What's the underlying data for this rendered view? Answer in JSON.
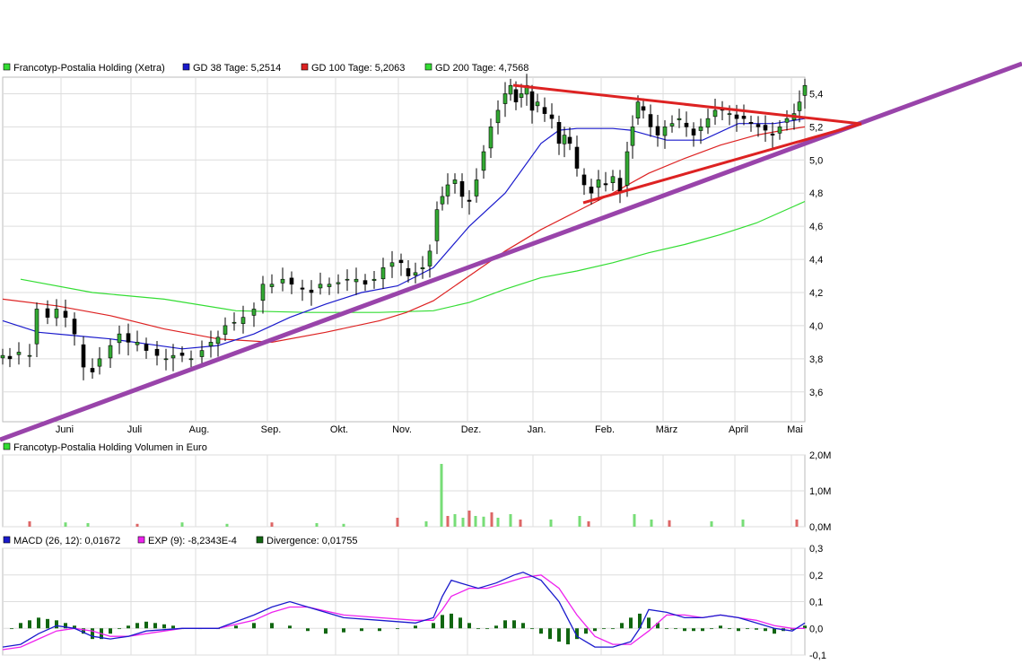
{
  "colors": {
    "price_up": "#33aa33",
    "price_down": "#000000",
    "gd38": "#1a1acc",
    "gd100": "#dd2222",
    "gd200": "#33dd33",
    "trend_red": "#dd2222",
    "trend_purple": "#9944aa",
    "vol_up": "#77dd77",
    "vol_down": "#dd6666",
    "macd": "#1a1acc",
    "exp": "#ee22ee",
    "divergence": "#116611",
    "grid": "#dddddd"
  },
  "panels": {
    "price": {
      "legend": [
        {
          "label": "Francotyp-Postalia Holding (Xetra)",
          "color": "#33dd33",
          "icon": "green-square-icon"
        },
        {
          "label": "GD 38 Tage: 5,2514",
          "color": "#1a1acc",
          "icon": "blue-square-icon"
        },
        {
          "label": "GD 100 Tage: 5,2063",
          "color": "#dd2222",
          "icon": "red-square-icon"
        },
        {
          "label": "GD 200 Tage: 4,7568",
          "color": "#33dd33",
          "icon": "green-square-icon"
        }
      ]
    },
    "volume": {
      "legend": [
        {
          "label": "Francotyp-Postalia Holding Volumen in Euro",
          "color": "#33dd33",
          "icon": "green-square-icon"
        }
      ]
    },
    "macd": {
      "legend": [
        {
          "label": "MACD (26, 12): 0,01672",
          "color": "#1a1acc",
          "icon": "blue-square-icon"
        },
        {
          "label": "EXP (9): -8,2343E-4",
          "color": "#ee22ee",
          "icon": "magenta-square-icon"
        },
        {
          "label": "Divergence: 0,01755",
          "color": "#116611",
          "icon": "darkgreen-square-icon"
        }
      ]
    }
  },
  "chart_data": [
    {
      "type": "line",
      "title": "",
      "x_axis": "time",
      "months": [
        "Juni",
        "Juli",
        "Aug.",
        "Sep.",
        "Okt.",
        "Nov.",
        "Dez.",
        "Jan.",
        "Feb.",
        "März",
        "April",
        "Mai"
      ],
      "yticks": [
        "3,6",
        "3,8",
        "4,0",
        "4,2",
        "4,4",
        "4,6",
        "4,8",
        "5,0",
        "5,2",
        "5,4"
      ],
      "ylim": [
        3.42,
        5.5
      ],
      "grid": true,
      "legend_position": "top-left",
      "series": [
        {
          "name": "Francotyp-Postalia Holding (Xetra)",
          "style": "candlestick",
          "x": [
            0,
            8,
            18,
            30,
            38,
            50,
            60,
            70,
            80,
            90,
            100,
            108,
            120,
            130,
            140,
            150,
            160,
            172,
            182,
            190,
            200,
            210,
            222,
            232,
            240,
            248,
            258,
            268,
            280,
            290,
            300,
            312,
            322,
            334,
            344,
            354,
            364,
            374,
            384,
            394,
            404,
            414,
            424,
            434,
            444,
            452,
            460,
            468,
            476,
            484,
            490,
            496,
            504,
            512,
            520,
            528,
            536,
            544,
            552,
            560,
            566,
            572,
            578,
            584,
            590,
            596,
            604,
            612,
            620,
            626,
            632,
            640,
            648,
            656,
            664,
            672,
            680,
            688,
            696,
            702,
            708,
            714,
            722,
            730,
            738,
            746,
            754,
            762,
            770,
            778,
            786,
            794,
            802,
            810,
            818,
            826,
            834,
            842,
            850,
            858,
            866,
            874,
            882,
            888,
            894
          ],
          "values": [
            3.82,
            3.8,
            3.84,
            3.82,
            4.1,
            4.05,
            4.1,
            4.05,
            3.95,
            3.75,
            3.72,
            3.8,
            3.88,
            3.95,
            3.9,
            3.9,
            3.85,
            3.82,
            3.8,
            3.82,
            3.82,
            3.8,
            3.85,
            3.9,
            3.93,
            4.0,
            4.02,
            4.05,
            4.1,
            4.25,
            4.25,
            4.28,
            4.25,
            4.22,
            4.2,
            4.25,
            4.25,
            4.26,
            4.28,
            4.28,
            4.25,
            4.28,
            4.35,
            4.38,
            4.38,
            4.3,
            4.32,
            4.35,
            4.45,
            4.7,
            4.78,
            4.85,
            4.88,
            4.78,
            4.75,
            4.88,
            5.05,
            5.2,
            5.3,
            5.4,
            5.45,
            5.35,
            5.4,
            5.45,
            5.3,
            5.35,
            5.28,
            5.25,
            5.1,
            5.15,
            5.1,
            4.95,
            4.85,
            4.8,
            4.88,
            4.85,
            4.9,
            4.8,
            5.05,
            5.2,
            5.35,
            5.3,
            5.2,
            5.15,
            5.2,
            5.22,
            5.25,
            5.2,
            5.15,
            5.2,
            5.25,
            5.3,
            5.3,
            5.28,
            5.25,
            5.25,
            5.22,
            5.2,
            5.18,
            5.15,
            5.2,
            5.25,
            5.28,
            5.35,
            5.45
          ]
        },
        {
          "name": "GD 38 Tage",
          "x": [
            0,
            40,
            80,
            120,
            160,
            200,
            240,
            280,
            320,
            360,
            400,
            440,
            480,
            520,
            560,
            600,
            620,
            640,
            660,
            680,
            700,
            740,
            780,
            820,
            860,
            894
          ],
          "values": [
            4.03,
            3.96,
            3.94,
            3.92,
            3.89,
            3.86,
            3.88,
            3.95,
            4.05,
            4.13,
            4.2,
            4.24,
            4.35,
            4.6,
            4.8,
            5.1,
            5.18,
            5.19,
            5.19,
            5.19,
            5.18,
            5.12,
            5.12,
            5.22,
            5.22,
            5.25
          ]
        },
        {
          "name": "GD 100 Tage",
          "x": [
            0,
            60,
            120,
            180,
            240,
            300,
            360,
            420,
            450,
            480,
            520,
            560,
            600,
            640,
            680,
            720,
            760,
            800,
            840,
            870,
            894
          ],
          "values": [
            4.16,
            4.12,
            4.06,
            3.98,
            3.92,
            3.9,
            3.96,
            4.03,
            4.08,
            4.15,
            4.3,
            4.45,
            4.58,
            4.69,
            4.8,
            4.92,
            5.01,
            5.09,
            5.15,
            5.18,
            5.2
          ]
        },
        {
          "name": "GD 200 Tage",
          "x": [
            20,
            100,
            180,
            260,
            340,
            420,
            480,
            520,
            560,
            600,
            640,
            680,
            720,
            760,
            800,
            840,
            894
          ],
          "values": [
            4.28,
            4.2,
            4.16,
            4.09,
            4.08,
            4.08,
            4.09,
            4.14,
            4.22,
            4.29,
            4.33,
            4.38,
            4.44,
            4.49,
            4.55,
            4.62,
            4.75
          ]
        }
      ]
    },
    {
      "type": "bar",
      "title": "",
      "yticks": [
        "0,0M",
        "1,0M",
        "2,0M"
      ],
      "ylim": [
        0,
        2.0
      ],
      "grid": true,
      "legend_position": "top-left",
      "series": [
        {
          "name": "Francotyp-Postalia Holding Volumen in Euro",
          "x": [
            30,
            70,
            95,
            150,
            200,
            250,
            300,
            350,
            380,
            440,
            472,
            489,
            496,
            504,
            513,
            520,
            527,
            536,
            545,
            552,
            566,
            577,
            611,
            643,
            653,
            704,
            723,
            743,
            790,
            825,
            885
          ],
          "values": [
            0.15,
            0.12,
            0.1,
            0.08,
            0.12,
            0.08,
            0.12,
            0.1,
            0.08,
            0.25,
            0.15,
            1.75,
            0.3,
            0.35,
            0.25,
            0.45,
            0.3,
            0.28,
            0.4,
            0.25,
            0.35,
            0.2,
            0.2,
            0.3,
            0.15,
            0.35,
            0.2,
            0.18,
            0.15,
            0.2,
            0.2
          ]
        }
      ]
    },
    {
      "type": "line",
      "title": "",
      "yticks": [
        "-0,1",
        "0,0",
        "0,1",
        "0,2",
        "0,3"
      ],
      "ylim": [
        -0.1,
        0.3
      ],
      "grid": true,
      "legend_position": "top-left",
      "series": [
        {
          "name": "MACD (26, 12)",
          "x": [
            0,
            20,
            40,
            60,
            80,
            100,
            120,
            140,
            160,
            200,
            240,
            280,
            300,
            320,
            340,
            380,
            420,
            460,
            480,
            490,
            500,
            510,
            530,
            550,
            570,
            580,
            600,
            620,
            640,
            660,
            680,
            700,
            710,
            720,
            740,
            760,
            780,
            800,
            820,
            840,
            860,
            880,
            894
          ],
          "values": [
            -0.07,
            -0.06,
            -0.02,
            0.01,
            0.0,
            -0.03,
            -0.04,
            -0.03,
            -0.01,
            0.0,
            0.0,
            0.05,
            0.08,
            0.1,
            0.08,
            0.04,
            0.03,
            0.02,
            0.04,
            0.12,
            0.18,
            0.17,
            0.15,
            0.17,
            0.2,
            0.21,
            0.18,
            0.1,
            -0.03,
            -0.07,
            -0.07,
            -0.05,
            0.0,
            0.07,
            0.06,
            0.04,
            0.04,
            0.05,
            0.04,
            0.02,
            0.0,
            -0.01,
            0.02
          ]
        },
        {
          "name": "EXP (9)",
          "x": [
            0,
            20,
            40,
            60,
            80,
            100,
            120,
            140,
            160,
            200,
            240,
            280,
            300,
            320,
            340,
            380,
            420,
            460,
            480,
            490,
            500,
            520,
            540,
            560,
            580,
            600,
            620,
            640,
            660,
            680,
            700,
            720,
            740,
            760,
            780,
            800,
            820,
            840,
            860,
            880,
            894
          ],
          "values": [
            -0.08,
            -0.07,
            -0.04,
            -0.01,
            0.0,
            -0.01,
            -0.03,
            -0.03,
            -0.02,
            0.0,
            0.0,
            0.03,
            0.06,
            0.08,
            0.08,
            0.05,
            0.04,
            0.03,
            0.03,
            0.07,
            0.12,
            0.15,
            0.15,
            0.17,
            0.19,
            0.2,
            0.15,
            0.05,
            -0.03,
            -0.06,
            -0.06,
            -0.01,
            0.05,
            0.05,
            0.04,
            0.05,
            0.04,
            0.03,
            0.01,
            0.0,
            0.0
          ]
        },
        {
          "name": "Divergence",
          "style": "histogram",
          "x": [
            10,
            20,
            30,
            40,
            50,
            60,
            70,
            80,
            90,
            100,
            110,
            120,
            130,
            140,
            150,
            160,
            170,
            180,
            190,
            200,
            220,
            240,
            260,
            280,
            300,
            320,
            340,
            360,
            380,
            400,
            420,
            440,
            460,
            480,
            490,
            500,
            510,
            520,
            530,
            540,
            550,
            560,
            570,
            580,
            590,
            600,
            610,
            620,
            630,
            640,
            650,
            660,
            670,
            680,
            690,
            700,
            710,
            720,
            730,
            740,
            750,
            760,
            770,
            780,
            790,
            800,
            810,
            820,
            830,
            840,
            850,
            860,
            870,
            880,
            894
          ],
          "values": [
            0.0,
            0.02,
            0.03,
            0.04,
            0.035,
            0.03,
            0.02,
            0.01,
            -0.02,
            -0.04,
            -0.04,
            -0.02,
            0.0,
            0.01,
            0.02,
            0.025,
            0.02,
            0.015,
            0.01,
            0.0,
            0.0,
            0.0,
            0.01,
            0.02,
            0.02,
            0.01,
            -0.01,
            -0.02,
            -0.015,
            -0.01,
            -0.01,
            0.0,
            0.01,
            0.02,
            0.05,
            0.055,
            0.04,
            0.02,
            0.0,
            0.0,
            0.01,
            0.03,
            0.03,
            0.02,
            0.0,
            -0.02,
            -0.04,
            -0.05,
            -0.06,
            -0.04,
            -0.02,
            -0.01,
            0.0,
            0.0,
            0.02,
            0.04,
            0.055,
            0.04,
            0.02,
            0.0,
            0.0,
            -0.01,
            -0.01,
            -0.01,
            0.0,
            0.01,
            0.0,
            -0.01,
            0.0,
            -0.005,
            -0.01,
            -0.02,
            -0.01,
            -0.005,
            0.01
          ]
        }
      ]
    }
  ]
}
